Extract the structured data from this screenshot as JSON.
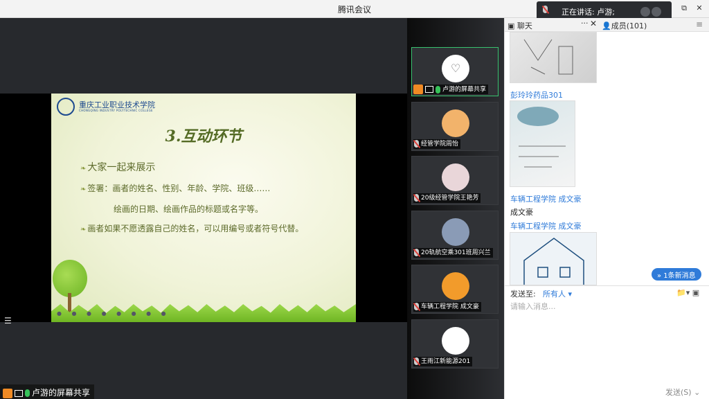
{
  "window": {
    "title": "腾讯会议",
    "restore_label": "⧉",
    "close_label": "✕"
  },
  "speaking": {
    "text": "正在讲话: 卢游;"
  },
  "share": {
    "label": "卢游的屏幕共享",
    "slide": {
      "logo_text": "重庆工业职业技术学院",
      "logo_sub": "CHONGQING INDUSTRY POLYTECHNIC COLLEGE",
      "title": "3.互动环节",
      "line1": "大家一起来展示",
      "line2": "签署：画者的姓名、性别、年龄、学院、班级……",
      "line3": "绘画的日期、绘画作品的标题或名字等。",
      "line4": "画者如果不愿透露自己的姓名，可以用编号或者符号代替。",
      "controls": "● ● ● ● ● ● ● ●"
    }
  },
  "videos": [
    {
      "name": "卢游的屏幕共享",
      "active": true,
      "avatar": "heart-icon",
      "color": "#ffffff"
    },
    {
      "name": "经管学院周怡",
      "active": false,
      "avatar": "avatar-photo",
      "color": "#f2b36b"
    },
    {
      "name": "20级经管学院王艳芳",
      "active": false,
      "avatar": "avatar-photo",
      "color": "#e9d6d9"
    },
    {
      "name": "20轨航空乘301班周兴兰",
      "active": false,
      "avatar": "avatar-photo",
      "color": "#8a9bb6"
    },
    {
      "name": "车辆工程学院  成文豪",
      "active": false,
      "avatar": "avatar-photo",
      "color": "#f29b2b"
    },
    {
      "name": "王雨江新能源201",
      "active": false,
      "avatar": "avatar-photo",
      "color": "#ffffff"
    }
  ],
  "chat": {
    "tab_chat": "聊天",
    "tab_members": "成员(101)",
    "messages": [
      {
        "sender": "彭玲玲药品301"
      },
      {
        "sender": "车辆工程学院  成文豪"
      },
      {
        "text": "成文豪"
      },
      {
        "sender": "车辆工程学院  成文豪"
      }
    ],
    "new_msg": "1条新消息",
    "send_to_label": "发送至:",
    "recipient": "所有人",
    "placeholder": "请输入消息...",
    "send_label": "发送(S)"
  },
  "colors": {
    "accent": "#2f7bd9",
    "active_border": "#38c26f",
    "mic_on": "#37c25a",
    "share_user": "#f08a24"
  }
}
